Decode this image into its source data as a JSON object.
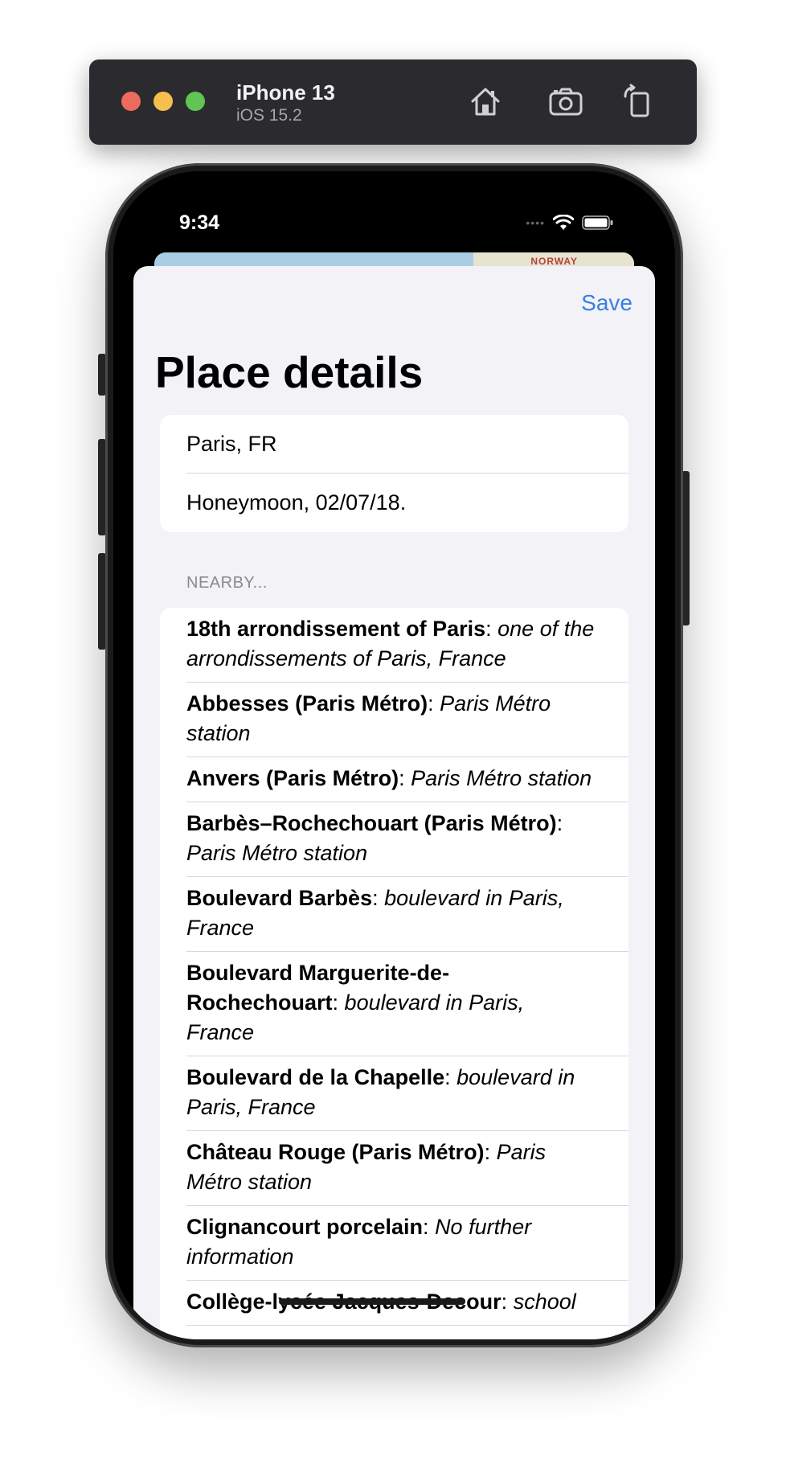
{
  "simulator": {
    "title": "iPhone 13",
    "subtitle": "iOS 15.2",
    "buttons": [
      "home-icon",
      "screenshot-icon",
      "rotate-icon"
    ]
  },
  "status_bar": {
    "time": "9:34",
    "icons": [
      "signal-icon",
      "wifi-icon",
      "battery-icon"
    ]
  },
  "map_peek": {
    "label": "NORWAY"
  },
  "sheet": {
    "save_label": "Save",
    "title": "Place details",
    "place_name": "Paris, FR",
    "place_note": "Honeymoon, 02/07/18.",
    "nearby_header": "NEARBY...",
    "nearby": [
      {
        "name": "18th arrondissement of Paris",
        "desc": "one of the arrondissements of Paris, France"
      },
      {
        "name": "Abbesses (Paris Métro)",
        "desc": "Paris Métro station"
      },
      {
        "name": "Anvers (Paris Métro)",
        "desc": "Paris Métro station"
      },
      {
        "name": "Barbès–Rochechouart (Paris Métro)",
        "desc": "Paris Métro station"
      },
      {
        "name": "Boulevard Barbès",
        "desc": "boulevard in Paris, France"
      },
      {
        "name": "Boulevard Marguerite-de-Rochechouart",
        "desc": "boulevard in Paris, France"
      },
      {
        "name": "Boulevard de la Chapelle",
        "desc": "boulevard in Paris, France"
      },
      {
        "name": "Château Rouge (Paris Métro)",
        "desc": "Paris Métro station"
      },
      {
        "name": "Clignancourt porcelain",
        "desc": "No further information"
      },
      {
        "name": "Collège-lycée Jacques-Decour",
        "desc": "school"
      }
    ]
  },
  "colors": {
    "accent": "#3a7fe0",
    "sheet_background": "#f2f2f7",
    "group_background": "#ffffff"
  }
}
